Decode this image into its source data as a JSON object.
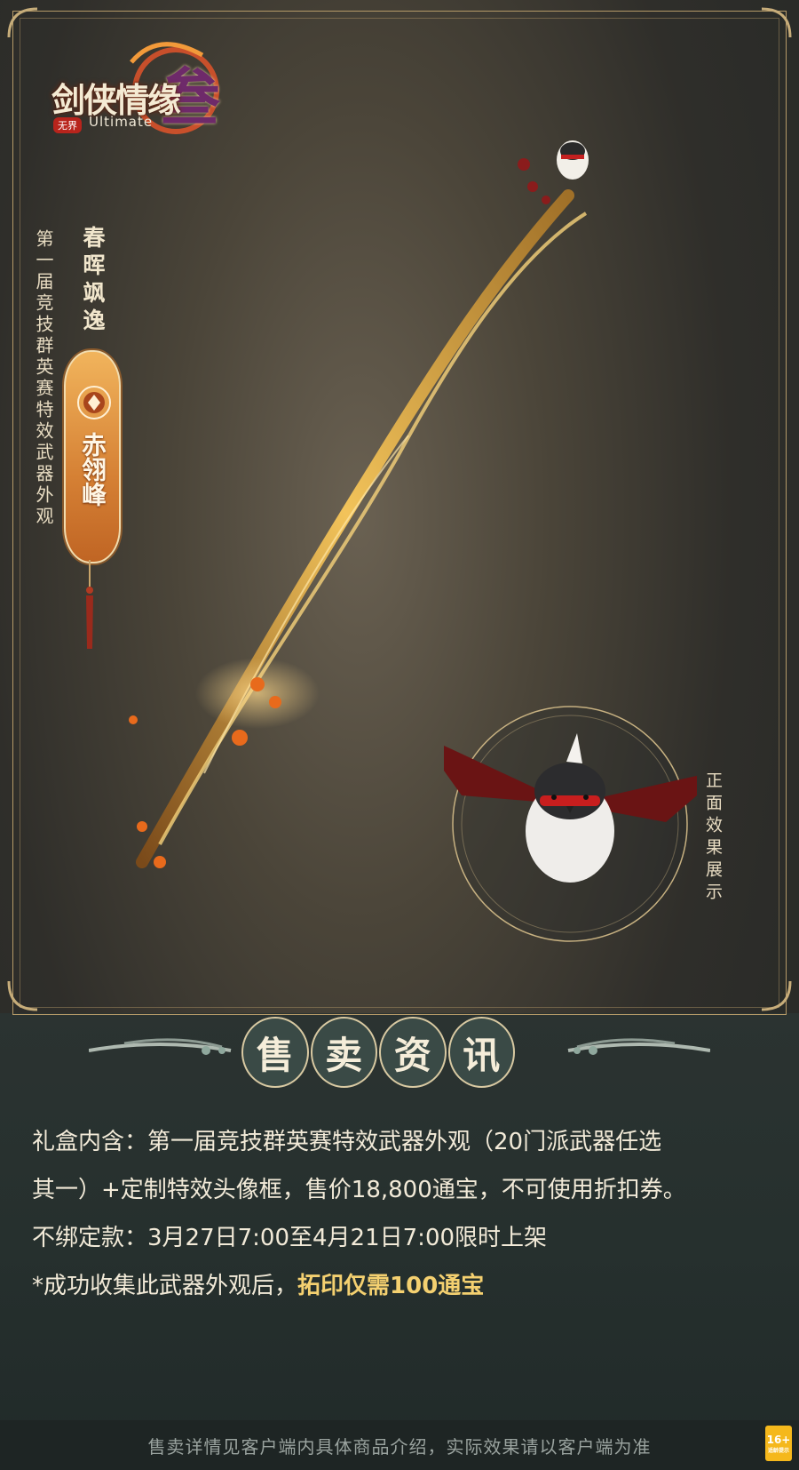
{
  "logo": {
    "title": "剑侠情缘",
    "big_char": "叁",
    "badge": "无界",
    "edition": "Ultimate"
  },
  "poster": {
    "vertical_title": "第一届竞技群英赛特效武器外观",
    "item_name": "春晖飒逸",
    "school_name": "赤翎峰",
    "front_caption": "正面效果展示"
  },
  "sales": {
    "heading": [
      "售",
      "卖",
      "资",
      "讯"
    ],
    "line1": "礼盒内含：第一届竞技群英赛特效武器外观（20门派武器任选",
    "line2": "其一）+定制特效头像框，售价18,800通宝，不可使用折扣券。",
    "line3": "不绑定款：3月27日7:00至4月21日7:00限时上架",
    "line4_prefix": "*成功收集此武器外观后，",
    "line4_highlight": "拓印仅需100通宝"
  },
  "footer": {
    "note": "售卖详情见客户端内具体商品介绍，实际效果请以客户端为准",
    "age_rating": "16+",
    "age_sub": "适龄提示"
  },
  "colors": {
    "accent_gold": "#f4d070",
    "plaque_orange": "#d58034",
    "frame_gold": "#b59a68"
  }
}
